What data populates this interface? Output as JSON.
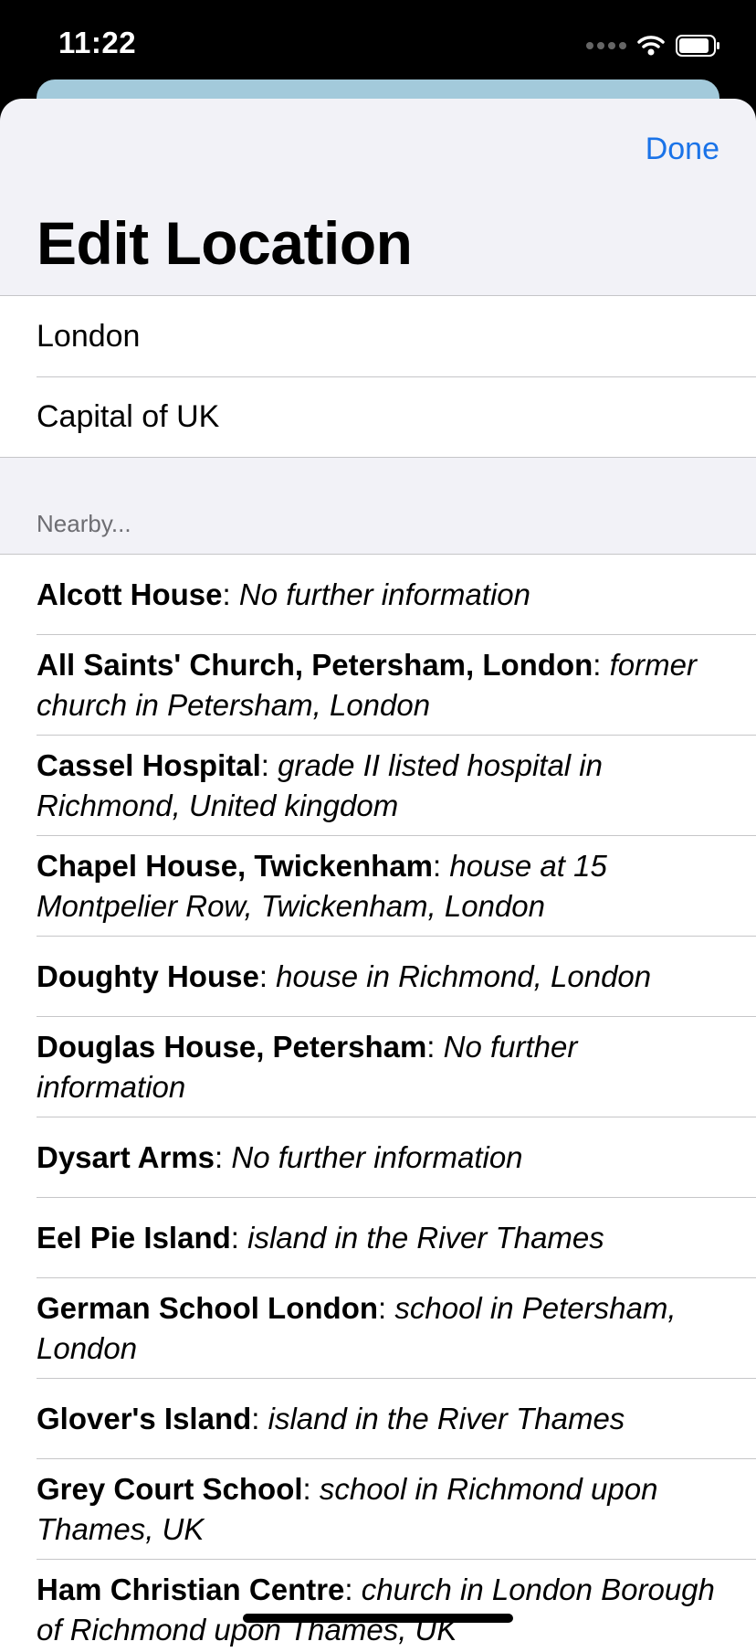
{
  "status_bar": {
    "time": "11:22"
  },
  "sheet": {
    "done_label": "Done",
    "title": "Edit Location"
  },
  "fields": {
    "name_value": "London",
    "description_value": "Capital of UK"
  },
  "nearby": {
    "header": "Nearby...",
    "items": [
      {
        "name": "Alcott House",
        "sep": ": ",
        "desc": "No further information"
      },
      {
        "name": "All Saints' Church, Petersham, London",
        "sep": ": ",
        "desc": "former church in Petersham, London"
      },
      {
        "name": "Cassel Hospital",
        "sep": ": ",
        "desc": "grade II listed hospital in Richmond, United kingdom"
      },
      {
        "name": "Chapel House, Twickenham",
        "sep": ": ",
        "desc": "house at 15 Montpelier Row, Twickenham, London"
      },
      {
        "name": "Doughty House",
        "sep": ": ",
        "desc": "house in Richmond, London"
      },
      {
        "name": "Douglas House, Petersham",
        "sep": ": ",
        "desc": "No further information"
      },
      {
        "name": "Dysart Arms",
        "sep": ": ",
        "desc": "No further information"
      },
      {
        "name": "Eel Pie Island",
        "sep": ": ",
        "desc": "island in the River Thames"
      },
      {
        "name": "German School London",
        "sep": ": ",
        "desc": "school in Petersham, London"
      },
      {
        "name": "Glover's Island",
        "sep": ": ",
        "desc": "island in the River Thames"
      },
      {
        "name": "Grey Court School",
        "sep": ": ",
        "desc": "school in Richmond upon Thames, UK"
      },
      {
        "name": "Ham Christian Centre",
        "sep": ": ",
        "desc": "church in London Borough of Richmond upon Thames, UK"
      }
    ]
  },
  "colors": {
    "accent": "#1a73e8",
    "back_card": "#a3cadb",
    "grouped_bg": "#f2f2f7"
  }
}
